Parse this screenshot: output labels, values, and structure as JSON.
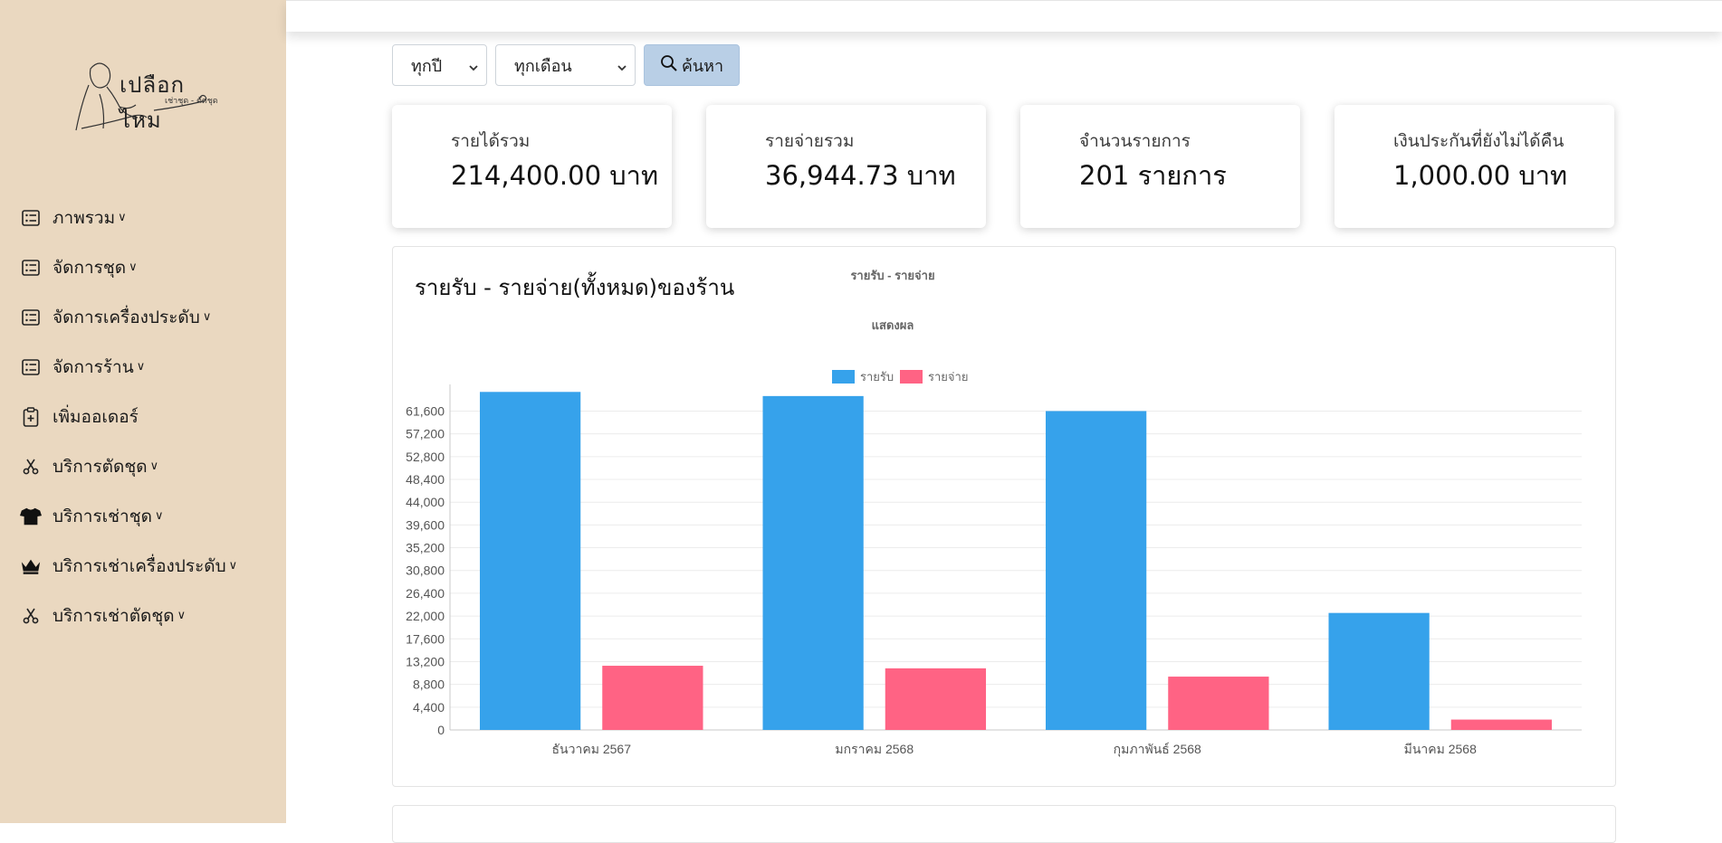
{
  "sidebar": {
    "logo_title": "เปลือกไหม",
    "logo_subtitle": "เช่าชุด - ตัดชุด",
    "items": [
      {
        "label": "ภาพรวม",
        "icon": "list-icon",
        "has_chevron": true
      },
      {
        "label": "จัดการชุด",
        "icon": "list-icon",
        "has_chevron": true
      },
      {
        "label": "จัดการเครื่องประดับ",
        "icon": "list-icon",
        "has_chevron": true
      },
      {
        "label": "จัดการร้าน",
        "icon": "list-icon",
        "has_chevron": true
      },
      {
        "label": "เพิ่มออเดอร์",
        "icon": "clipboard-plus-icon",
        "has_chevron": false
      },
      {
        "label": "บริการตัดชุด",
        "icon": "scissors-icon",
        "has_chevron": true
      },
      {
        "label": "บริการเช่าชุด",
        "icon": "tshirt-icon",
        "has_chevron": true
      },
      {
        "label": "บริการเช่าเครื่องประดับ",
        "icon": "crown-icon",
        "has_chevron": true
      },
      {
        "label": "บริการเช่าตัดชุด",
        "icon": "scissors-icon",
        "has_chevron": true
      }
    ]
  },
  "filters": {
    "year_value": "ทุกปี",
    "month_value": "ทุกเดือน",
    "search_label": "ค้นหา"
  },
  "cards": [
    {
      "label": "รายได้รวม",
      "value": "214,400.00 บาท"
    },
    {
      "label": "รายจ่ายรวม",
      "value": "36,944.73 บาท"
    },
    {
      "label": "จำนวนรายการ",
      "value": "201 รายการ"
    },
    {
      "label": "เงินประกันที่ยังไม่ได้คืน",
      "value": "1,000.00 บาท"
    }
  ],
  "panel": {
    "title": "รายรับ - รายจ่าย(ทั้งหมด)ของร้าน"
  },
  "chart_data": {
    "type": "bar",
    "title": "รายรับ - รายจ่าย",
    "subtitle": "แสดงผล",
    "categories": [
      "ธันวาคม 2567",
      "มกราคม 2568",
      "กุมภาพันธ์ 2568",
      "มีนาคม 2568"
    ],
    "series": [
      {
        "name": "รายรับ",
        "color": "#36a2eb",
        "values": [
          65300,
          64500,
          61600,
          22600
        ]
      },
      {
        "name": "รายจ่าย",
        "color": "#ff6384",
        "values": [
          12400,
          11900,
          10300,
          2000
        ]
      }
    ],
    "y_ticks": [
      0,
      4400,
      8800,
      13200,
      17600,
      22000,
      26400,
      30800,
      35200,
      39600,
      44000,
      48400,
      52800,
      57200,
      61600
    ],
    "ylim": [
      0,
      65700
    ],
    "grid": true,
    "legend_position": "top"
  }
}
